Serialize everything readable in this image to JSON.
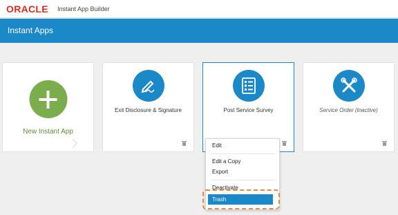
{
  "header": {
    "logo_text": "ORACLE",
    "app_title": "Instant App Builder"
  },
  "banner": {
    "title": "Instant Apps"
  },
  "cards": [
    {
      "label": "New Instant App",
      "icon": "plus-icon",
      "color": "#7aae4c"
    },
    {
      "label": "Exit Disclosure & Signature",
      "icon": "pen-icon",
      "color": "#1b88c8"
    },
    {
      "label": "Post Service Survey",
      "icon": "checklist-icon",
      "color": "#1b88c8"
    },
    {
      "label": "Service Order (Inactive)",
      "icon": "tools-icon",
      "color": "#1b88c8"
    }
  ],
  "context_menu": {
    "items": [
      "Edit",
      "Edit a Copy",
      "Export",
      "Deactivate",
      "Trash"
    ],
    "active_item": "Trash"
  },
  "colors": {
    "brand_red": "#e02a20",
    "accent_blue": "#1b88c8",
    "new_app_green": "#7aae4c",
    "highlight_orange": "#e8893a"
  }
}
